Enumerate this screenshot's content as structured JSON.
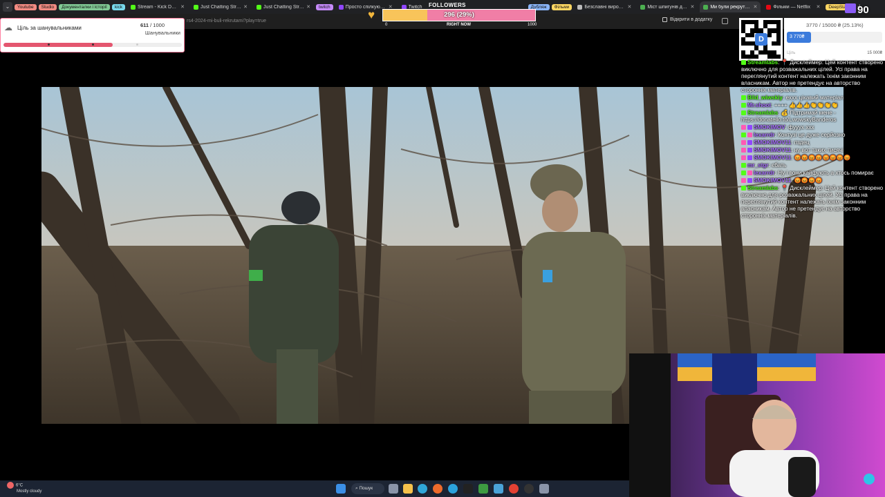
{
  "browser": {
    "tab_groups": [
      {
        "label": "Youtube",
        "color": "#f28b82"
      },
      {
        "label": "Studio",
        "color": "#f28b82"
      },
      {
        "label": "Документалки і історії",
        "color": "#81c995"
      },
      {
        "label": "kick",
        "color": "#78d9ec"
      }
    ],
    "tabs": [
      {
        "title": "Stream - Kick Dashbo...",
        "favicon_color": "#53fc18"
      },
      {
        "title": "Just Chatting Stream...",
        "favicon_color": "#53fc18"
      },
      {
        "title": "Just Chatting Stream...",
        "favicon_color": "#53fc18"
      }
    ],
    "twitch_group": {
      "label": "twitch",
      "color": "#c58af9"
    },
    "tabs2": [
      {
        "title": "Просто спілкуюся з...",
        "favicon_color": "#9146ff"
      },
      {
        "title": "Twitch",
        "favicon_color": "#9146ff"
      }
    ],
    "dub_group": {
      "label": "Дубляж",
      "color": "#8ab4f8"
    },
    "films_group": {
      "label": "Фільми",
      "color": "#fdd663"
    },
    "tabs3": [
      {
        "title": "Безславні виродки...",
        "favicon_color": "#bbb"
      },
      {
        "title": "Міст шпигунів дивит...",
        "favicon_color": "#4caf50"
      },
      {
        "title": "Ми були рекрутами",
        "favicon_color": "#4caf50",
        "active": true
      },
      {
        "title": "Фільми — Netflix",
        "favicon_color": "#e50914"
      }
    ],
    "deepstate_group": {
      "label": "DeepState",
      "color": "#fdd663"
    },
    "new_tab": "+",
    "url": "rs4-2024-mi-buli-rekrutami?play=true",
    "open_in_app": "Відкрити в додатку"
  },
  "goal_widget": {
    "title": "Ціль за шанувальниками",
    "current": "611",
    "total": "/ 1000",
    "subtitle": "Шанувальники",
    "progress": 0.611
  },
  "followers_bar": {
    "label": "FOLLOWERS",
    "value_text": "296 (29%)",
    "progress": 0.29,
    "min": "0",
    "mid": "RIGHT NOW",
    "max": "1000"
  },
  "donation_goal": {
    "amount_text": "3770 / 15000 ₴ (25.13%)",
    "fill_label": "3 770₴",
    "progress": 0.2513,
    "goal_label": "Ціль",
    "max_label": "15 000₴"
  },
  "overlay_counter": "90",
  "chat": [
    {
      "name": "Streamlabs",
      "name_color": "#53fc18",
      "text": "📍 Дисклеймер: Цей контент створено виключно для розважальних цілей. Усі права на переглянутий контент належать їхнім законним власникам. Автор не претендує на авторство сторонніх матеріалів.",
      "badges": [
        "#53fc18"
      ]
    },
    {
      "name": "Bild_wiwskiy",
      "name_color": "#53fc18",
      "text": "еххх цікавий матеріал",
      "badges": [
        "#53fc18"
      ]
    },
    {
      "name": "Mr.shoot",
      "name_color": "#a970ff",
      "text": "++++ 👍👍👍👏👏👏👏",
      "badges": [
        "#53fc18"
      ]
    },
    {
      "name": "Streamlabs",
      "name_color": "#53fc18",
      "text": "💰 Підтримай мене - https://donatello.to/LwowskyBanderos",
      "badges": [
        "#53fc18"
      ]
    },
    {
      "name": "SMOKIMOV",
      "name_color": "#a970ff",
      "text": "фууух ххх",
      "badges": [
        "#ff5ab4",
        "#9146ff"
      ]
    },
    {
      "name": "lexarrdr",
      "name_color": "#a970ff",
      "text": "Контузі це дуже серйозно",
      "badges": [
        "#53fc18",
        "#ff5ab4"
      ]
    },
    {
      "name": "SMOKIMOV11",
      "name_color": "#a970ff",
      "text": "пздец",
      "badges": [
        "#ff5ab4",
        "#9146ff"
      ]
    },
    {
      "name": "SMOKIMOV11",
      "name_color": "#a970ff",
      "text": "ну вот таких тисячі",
      "badges": [
        "#ff5ab4",
        "#9146ff"
      ]
    },
    {
      "name": "SMOKIMOV11",
      "name_color": "#a970ff",
      "text": "😡😡😡😡😡😡😡😡",
      "badges": [
        "#ff5ab4",
        "#9146ff"
      ]
    },
    {
      "name": "mr_stgr",
      "name_color": "#a970ff",
      "text": "єбать",
      "badges": [
        "#53fc18"
      ]
    },
    {
      "name": "lexarrdr",
      "name_color": "#a970ff",
      "text": "Ну і вони кайфують а хтось помирає",
      "badges": [
        "#53fc18",
        "#ff5ab4"
      ]
    },
    {
      "name": "SMOKIMOV11",
      "name_color": "#a970ff",
      "text": "😡😡😡😡",
      "badges": [
        "#ff5ab4",
        "#9146ff"
      ]
    },
    {
      "name": "Streamlabs",
      "name_color": "#53fc18",
      "text": "📍 Дисклеймер: Цей контент створено виключно для розважальних цілей. Усі права на переглянутий контент належать їхнім законним власникам. Автор не претендує на авторство сторонніх матеріалів.",
      "badges": [
        "#53fc18"
      ]
    }
  ],
  "taskbar": {
    "weather_temp": "6°C",
    "weather_desc": "Mostly cloudy",
    "search_label": "Пошук",
    "icons": [
      "windows-start-icon",
      "search-icon",
      "task-view-icon",
      "file-explorer-icon",
      "edge-icon",
      "firefox-icon",
      "telegram-icon",
      "terminal-icon",
      "xbox-icon",
      "photos-icon",
      "chrome-icon",
      "obs-icon",
      "settings-icon"
    ]
  },
  "colors": {
    "goal_fill": "#e4566f",
    "followers_fill": "#f8c45a",
    "followers_bg": "#f07ea6",
    "donation_fill": "#3b7bdc"
  }
}
